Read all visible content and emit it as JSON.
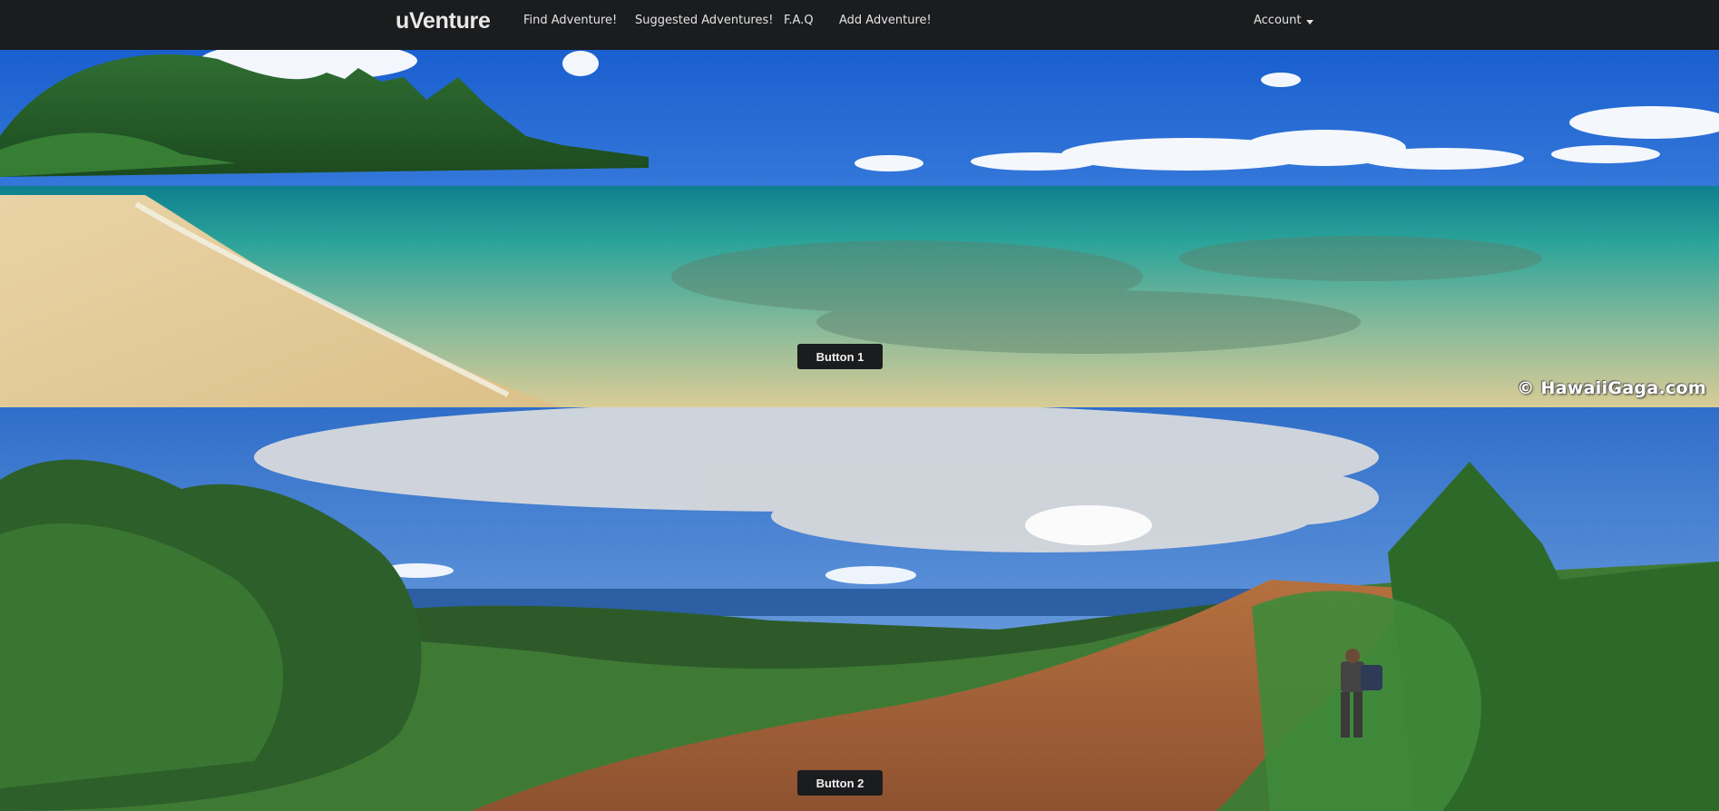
{
  "navbar": {
    "brand": "uVenture",
    "links": [
      "Find Adventure!",
      "Suggested Adventures!",
      "F.A.Q",
      "Add Adventure!"
    ],
    "account": "Account"
  },
  "panels": [
    {
      "button_label": "Button 1",
      "watermark": "© HawaiiGaga.com"
    },
    {
      "button_label": "Button 2"
    }
  ],
  "colors": {
    "navbar_bg": "#1b1c1e",
    "nav_text": "#e4e4e4",
    "button_bg": "#1b1c1e",
    "button_text": "#f1f1f1"
  }
}
